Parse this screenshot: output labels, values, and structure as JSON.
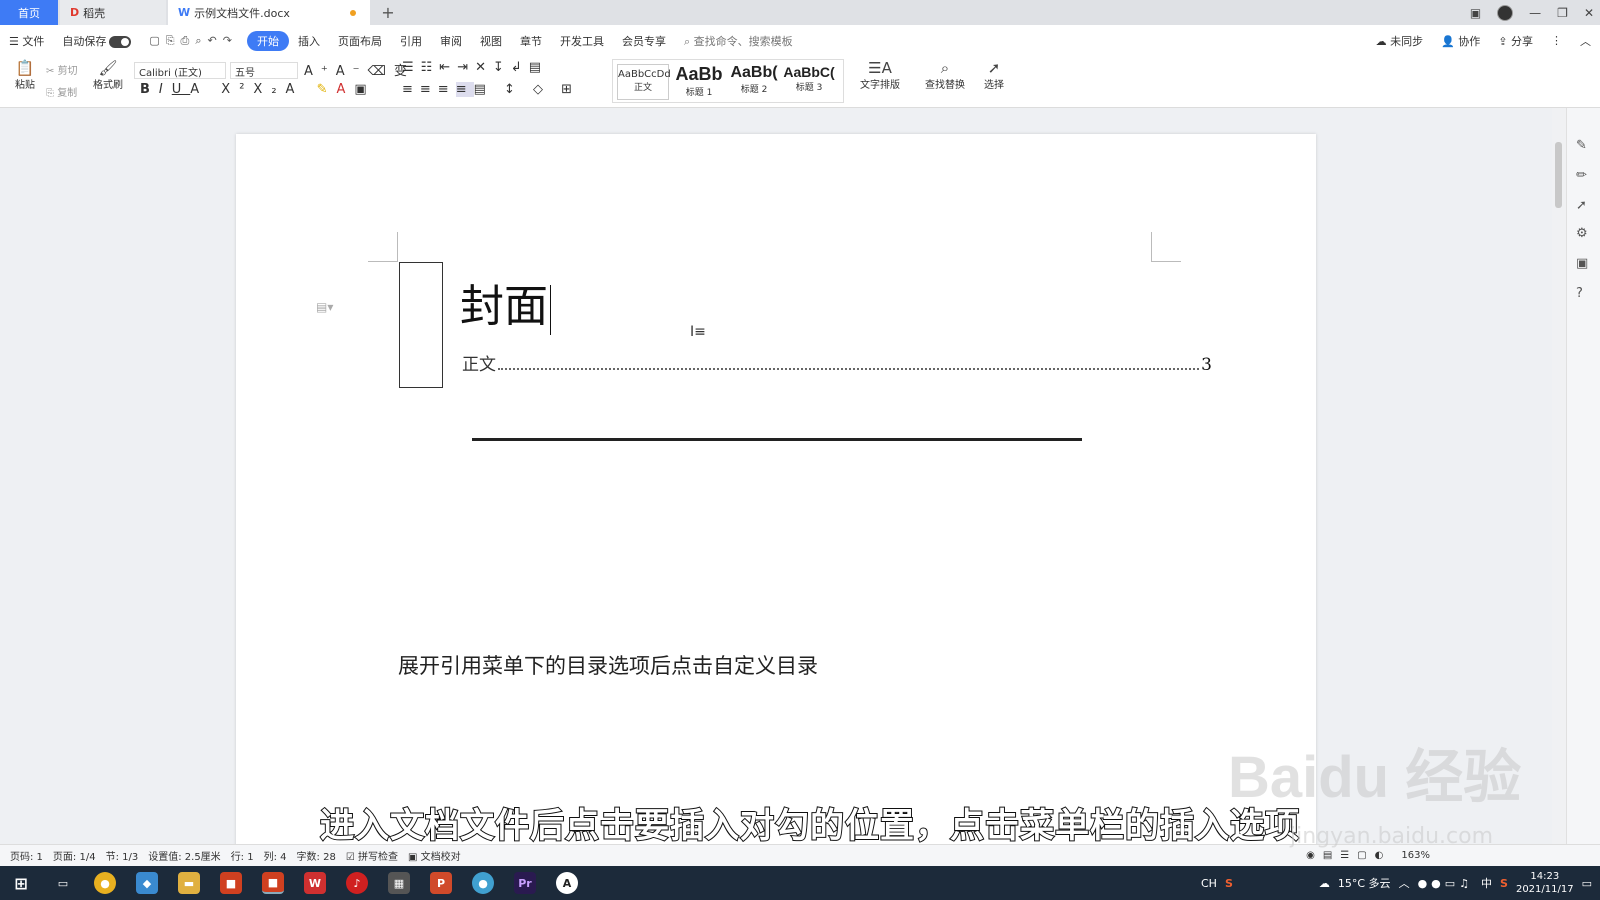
{
  "tabs": {
    "home": "首页",
    "daoke": "稻壳",
    "doc": "示例文档文件.docx",
    "plus": "+"
  },
  "menubar": {
    "file": "文件",
    "autosave": "自动保存",
    "items": [
      "开始",
      "插入",
      "页面布局",
      "引用",
      "审阅",
      "视图",
      "章节",
      "开发工具",
      "会员专享"
    ],
    "search": "查找命令、搜索模板",
    "sync": "未同步",
    "collab": "协作",
    "share": "分享"
  },
  "ribbon": {
    "paste": "粘贴",
    "cut": "剪切",
    "copy": "复制",
    "format_painter": "格式刷",
    "font": "Calibri (正文)",
    "size": "五号",
    "styles": [
      {
        "preview": "AaBbCcDd",
        "label": "正文"
      },
      {
        "preview": "AaBb",
        "label": "标题 1"
      },
      {
        "preview": "AaBb(",
        "label": "标题 2"
      },
      {
        "preview": "AaBbC(",
        "label": "标题 3"
      }
    ],
    "text_layout": "文字排版",
    "find_replace": "查找替换",
    "select": "选择"
  },
  "doc": {
    "cover": "封面",
    "toc_entry": "正文",
    "toc_page": "3",
    "instruction": "展开引用菜单下的目录选项后点击自定义目录"
  },
  "subtitle": "进入文档文件后点击要插入对勾的位置，点击菜单栏的插入选项",
  "status": {
    "page": "页码: 1",
    "pages": "页面: 1/4",
    "section": "节: 1/3",
    "setting": "设置值: 2.5厘米",
    "line": "行: 1",
    "col": "列: 4",
    "words": "字数: 28",
    "spell": "拼写检查",
    "proof": "文档校对",
    "zoom": "163%"
  },
  "taskbar": {
    "ime": "CH",
    "weather": "15°C 多云",
    "lang": "中",
    "time": "14:23",
    "date": "2021/11/17"
  },
  "watermark": {
    "main": "Baidu 经验",
    "sub": "jingyan.baidu.com"
  },
  "colors": {
    "accent": "#3e7bf5",
    "taskbar": "#1c2a3a"
  }
}
